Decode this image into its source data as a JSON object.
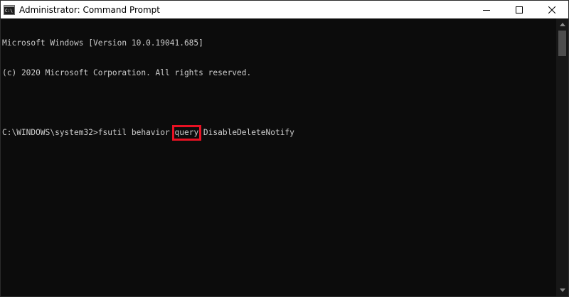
{
  "window": {
    "title": "Administrator: Command Prompt",
    "icon": "cmd-icon"
  },
  "caption": {
    "minimize_icon": "minimize-icon",
    "maximize_icon": "maximize-icon",
    "close_icon": "close-icon"
  },
  "console": {
    "lines": [
      "Microsoft Windows [Version 10.0.19041.685]",
      "(c) 2020 Microsoft Corporation. All rights reserved.",
      ""
    ],
    "command": {
      "prompt": "C:\\WINDOWS\\system32>",
      "before": "fsutil behavior ",
      "highlighted": "query",
      "after": " DisableDeleteNotify"
    }
  },
  "colors": {
    "console_bg": "#0c0c0c",
    "console_text": "#cccccc",
    "highlight": "#e81123"
  }
}
